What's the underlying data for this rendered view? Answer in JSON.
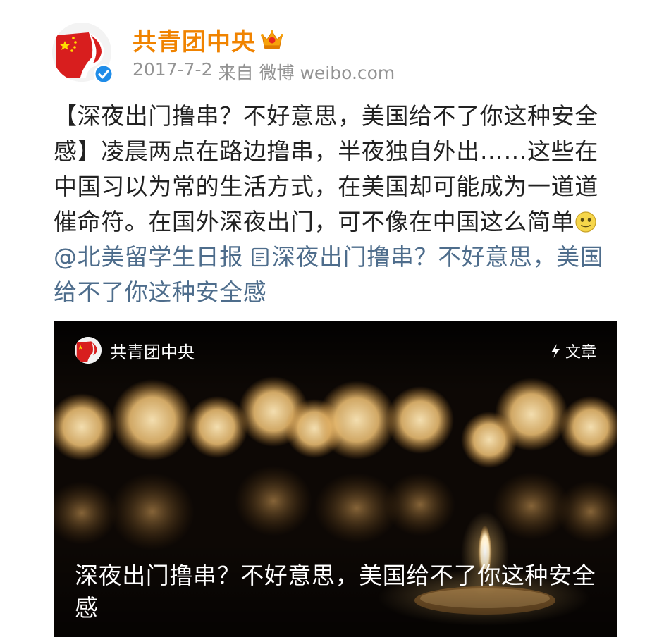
{
  "post": {
    "account_name": "共青团中央",
    "date": "2017-7-2",
    "source_prefix": "来自",
    "source_name": "微博 weibo.com",
    "text_main": "【深夜出门撸串？不好意思，美国给不了你这种安全感】凌晨两点在路边撸串，半夜独自外出……这些在中国习以为常的生活方式，在美国却可能成为一道道催命符。在国外深夜出门，可不像在中国这么简单",
    "mention": "@北美留学生日报",
    "link_text": "深夜出门撸串？不好意思，美国给不了你这种安全感"
  },
  "card": {
    "account_name": "共青团中央",
    "type_label": "文章",
    "title": "深夜出门撸串？不好意思，美国给不了你这种安全感"
  },
  "icons": {
    "avatar": "youth-league-logo",
    "verified": "verified-badge-icon",
    "membership": "crown-icon",
    "emoji": "smile-emoji-icon",
    "link": "article-link-icon",
    "card_type": "lightning-icon"
  },
  "colors": {
    "account_name": "#f08300",
    "meta": "#939393",
    "body_text": "#222222",
    "link": "#4e6d8c",
    "verified": "#1f8ce8",
    "card_background": "#000000"
  }
}
